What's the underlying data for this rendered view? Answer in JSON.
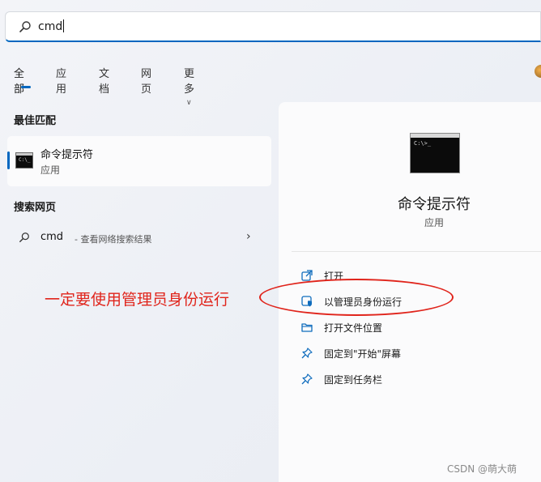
{
  "search": {
    "value": "cmd"
  },
  "tabs": [
    {
      "label": "全部",
      "active": true
    },
    {
      "label": "应用"
    },
    {
      "label": "文档"
    },
    {
      "label": "网页"
    },
    {
      "label": "更多"
    }
  ],
  "best_match": {
    "section_title": "最佳匹配",
    "title": "命令提示符",
    "subtitle": "应用",
    "icon": "cmd-app-icon"
  },
  "web_search": {
    "section_title": "搜索网页",
    "query": "cmd",
    "hint": "- 查看网络搜索结果"
  },
  "annotation": {
    "text": "一定要使用管理员身份运行",
    "color": "#e0241b"
  },
  "detail": {
    "title": "命令提示符",
    "subtitle": "应用",
    "actions": [
      {
        "label": "打开",
        "icon": "open-external-icon"
      },
      {
        "label": "以管理员身份运行",
        "icon": "admin-shield-icon"
      },
      {
        "label": "打开文件位置",
        "icon": "folder-icon"
      },
      {
        "label": "固定到\"开始\"屏幕",
        "icon": "pin-icon"
      },
      {
        "label": "固定到任务栏",
        "icon": "pin-icon"
      }
    ]
  },
  "watermark": "CSDN @萌大萌",
  "colors": {
    "accent": "#0067c0",
    "annotation": "#e0241b",
    "icon_blue": "#0f6cbd"
  }
}
